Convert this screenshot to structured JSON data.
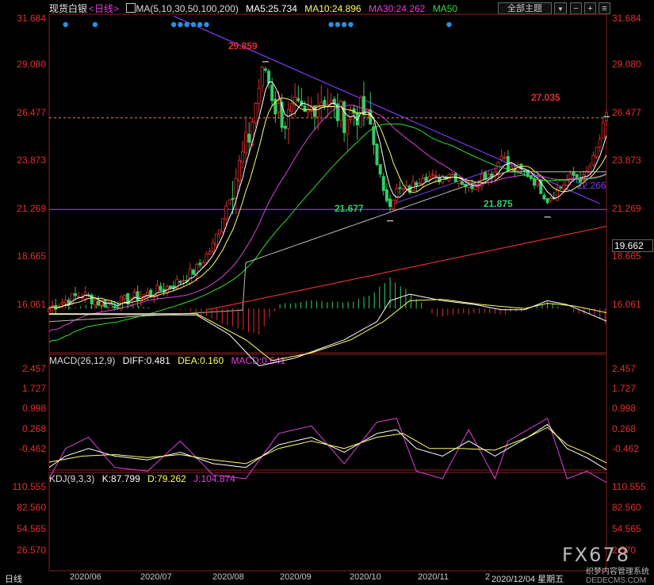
{
  "header": {
    "instrument": "现货白银",
    "period": "<日线>",
    "ma_label": "MA(5,10,30,50,100,200)",
    "ma5": "MA5:25.734",
    "ma10": "MA10:24.896",
    "ma30": "MA30:24.262",
    "ma50": "MA50",
    "theme_button": "全部主题",
    "theme_arrow": "▼"
  },
  "macd_header": {
    "label": "MACD(26,12,9)",
    "diff": "DIFF:0.481",
    "dea": "DEA:0.160",
    "macd": "MACD:0.641"
  },
  "kdj_header": {
    "label": "KDJ(9,3,3)",
    "k": "K:87.799",
    "d": "D:79.262",
    "j": "J:104.874"
  },
  "price_axis": [
    "31.684",
    "29.080",
    "26.477",
    "23.873",
    "21.269",
    "18.665",
    "16.061"
  ],
  "right_price_tag": "19.662",
  "macd_axis": [
    "2.457",
    "1.727",
    "0.998",
    "0.268",
    "-0.462"
  ],
  "kdj_axis": [
    "110.555",
    "82.560",
    "54.565",
    "26.570"
  ],
  "kdj_axis_right_last": "2.570",
  "x_labels": [
    "2020/06",
    "2020/07",
    "2020/08",
    "2020/09",
    "2020/10",
    "2020/11",
    "2"
  ],
  "date_tag": "2020/12/04 星期五",
  "bottom_left": "日线",
  "watermark": "FX678",
  "watermark_sub": "DEDECMS.COM",
  "watermark_cn": "织梦内容管理系统",
  "annotations": {
    "high": "29.859",
    "low1": "21.677",
    "low2": "21.875",
    "last": "27.035",
    "support": "22.266"
  },
  "colors": {
    "up": "#e0302c",
    "down": "#33cc66",
    "ma5": "#ffffff",
    "ma10": "#ffff66",
    "ma30": "#e040e0",
    "ma50": "#33dd33",
    "ma100": "#bbbbbb",
    "ma200": "#e0302c",
    "trend": "#7b3df0",
    "dea": "#ffff66",
    "j": "#e040e0"
  },
  "chart_data": {
    "type": "candlestick",
    "instrument": "现货白银",
    "y_range": [
      14.9,
      32.3
    ],
    "high": 29.859,
    "lows": [
      21.677,
      21.875
    ],
    "last_high": 27.035,
    "support_level": 22.266,
    "close_path": [
      [
        0,
        17.2
      ],
      [
        5,
        17.6
      ],
      [
        10,
        17.9
      ],
      [
        15,
        17.5
      ],
      [
        20,
        17.4
      ],
      [
        25,
        17.7
      ],
      [
        30,
        17.9
      ],
      [
        35,
        18.2
      ],
      [
        40,
        18.6
      ],
      [
        45,
        19.2
      ],
      [
        50,
        20.4
      ],
      [
        55,
        23.0
      ],
      [
        58,
        24.5
      ],
      [
        61,
        26.0
      ],
      [
        64,
        28.6
      ],
      [
        66,
        29.5
      ],
      [
        69,
        27.6
      ],
      [
        72,
        26.8
      ],
      [
        75,
        27.3
      ],
      [
        78,
        26.9
      ],
      [
        81,
        27.8
      ],
      [
        84,
        28.1
      ],
      [
        87,
        27.3
      ],
      [
        90,
        27.0
      ],
      [
        93,
        27.3
      ],
      [
        96,
        27.2
      ],
      [
        98,
        26.5
      ],
      [
        100,
        24.8
      ],
      [
        102,
        23.0
      ],
      [
        104,
        22.7
      ],
      [
        106,
        23.2
      ],
      [
        110,
        23.3
      ],
      [
        114,
        24.1
      ],
      [
        118,
        23.8
      ],
      [
        122,
        24.2
      ],
      [
        126,
        23.7
      ],
      [
        128,
        23.4
      ],
      [
        132,
        24.0
      ],
      [
        136,
        24.2
      ],
      [
        138,
        25.3
      ],
      [
        140,
        24.3
      ],
      [
        143,
        24.3
      ],
      [
        146,
        24.1
      ],
      [
        149,
        23.6
      ],
      [
        152,
        22.8
      ],
      [
        154,
        23.1
      ],
      [
        157,
        23.6
      ],
      [
        160,
        24.0
      ],
      [
        163,
        23.8
      ],
      [
        166,
        24.8
      ],
      [
        168,
        25.9
      ],
      [
        170,
        27.0
      ]
    ],
    "macd": {
      "dif": [
        [
          0,
          0.22
        ],
        [
          45,
          0.25
        ],
        [
          55,
          1.0
        ],
        [
          64,
          2.2
        ],
        [
          75,
          1.9
        ],
        [
          90,
          1.2
        ],
        [
          100,
          0.5
        ],
        [
          104,
          -0.3
        ],
        [
          110,
          -0.55
        ],
        [
          120,
          -0.3
        ],
        [
          130,
          -0.15
        ],
        [
          138,
          0.05
        ],
        [
          145,
          0.05
        ],
        [
          152,
          -0.3
        ],
        [
          158,
          -0.15
        ],
        [
          170,
          0.48
        ]
      ],
      "dea": [
        [
          0,
          0.2
        ],
        [
          45,
          0.2
        ],
        [
          60,
          1.2
        ],
        [
          68,
          2.0
        ],
        [
          80,
          1.7
        ],
        [
          92,
          1.2
        ],
        [
          102,
          0.5
        ],
        [
          110,
          -0.3
        ],
        [
          120,
          -0.35
        ],
        [
          132,
          -0.15
        ],
        [
          145,
          0.0
        ],
        [
          152,
          -0.2
        ],
        [
          160,
          -0.1
        ],
        [
          170,
          0.16
        ]
      ],
      "hist": [
        [
          0,
          0.1
        ],
        [
          10,
          -0.1
        ],
        [
          20,
          -0.18
        ],
        [
          30,
          -0.05
        ],
        [
          40,
          0.0
        ],
        [
          50,
          0.4
        ],
        [
          58,
          0.8
        ],
        [
          64,
          1.0
        ],
        [
          70,
          -0.15
        ],
        [
          80,
          -0.3
        ],
        [
          90,
          -0.2
        ],
        [
          98,
          -0.5
        ],
        [
          104,
          -1.2
        ],
        [
          110,
          -0.6
        ],
        [
          118,
          0.3
        ],
        [
          128,
          0.2
        ],
        [
          138,
          0.2
        ],
        [
          145,
          0.1
        ],
        [
          152,
          -0.25
        ],
        [
          160,
          0.15
        ],
        [
          166,
          0.25
        ],
        [
          170,
          0.64
        ]
      ]
    },
    "kdj": {
      "k": [
        [
          0,
          85
        ],
        [
          5,
          70
        ],
        [
          12,
          60
        ],
        [
          20,
          70
        ],
        [
          30,
          75
        ],
        [
          40,
          65
        ],
        [
          50,
          80
        ],
        [
          60,
          85
        ],
        [
          70,
          55
        ],
        [
          80,
          45
        ],
        [
          90,
          65
        ],
        [
          100,
          40
        ],
        [
          106,
          35
        ],
        [
          112,
          60
        ],
        [
          120,
          70
        ],
        [
          128,
          50
        ],
        [
          136,
          70
        ],
        [
          140,
          60
        ],
        [
          146,
          45
        ],
        [
          152,
          28
        ],
        [
          158,
          60
        ],
        [
          164,
          72
        ],
        [
          170,
          88
        ]
      ],
      "d": [
        [
          0,
          78
        ],
        [
          10,
          70
        ],
        [
          20,
          68
        ],
        [
          30,
          72
        ],
        [
          40,
          68
        ],
        [
          50,
          75
        ],
        [
          60,
          80
        ],
        [
          70,
          60
        ],
        [
          80,
          50
        ],
        [
          90,
          60
        ],
        [
          100,
          45
        ],
        [
          108,
          40
        ],
        [
          116,
          60
        ],
        [
          126,
          60
        ],
        [
          136,
          62
        ],
        [
          146,
          45
        ],
        [
          152,
          32
        ],
        [
          158,
          55
        ],
        [
          164,
          66
        ],
        [
          170,
          79
        ]
      ],
      "j": [
        [
          0,
          100
        ],
        [
          5,
          60
        ],
        [
          12,
          45
        ],
        [
          20,
          85
        ],
        [
          30,
          90
        ],
        [
          40,
          50
        ],
        [
          50,
          95
        ],
        [
          60,
          100
        ],
        [
          70,
          40
        ],
        [
          80,
          30
        ],
        [
          90,
          80
        ],
        [
          100,
          25
        ],
        [
          106,
          20
        ],
        [
          112,
          90
        ],
        [
          120,
          100
        ],
        [
          128,
          35
        ],
        [
          136,
          100
        ],
        [
          140,
          50
        ],
        [
          146,
          35
        ],
        [
          152,
          20
        ],
        [
          158,
          100
        ],
        [
          164,
          90
        ],
        [
          170,
          105
        ]
      ]
    }
  }
}
